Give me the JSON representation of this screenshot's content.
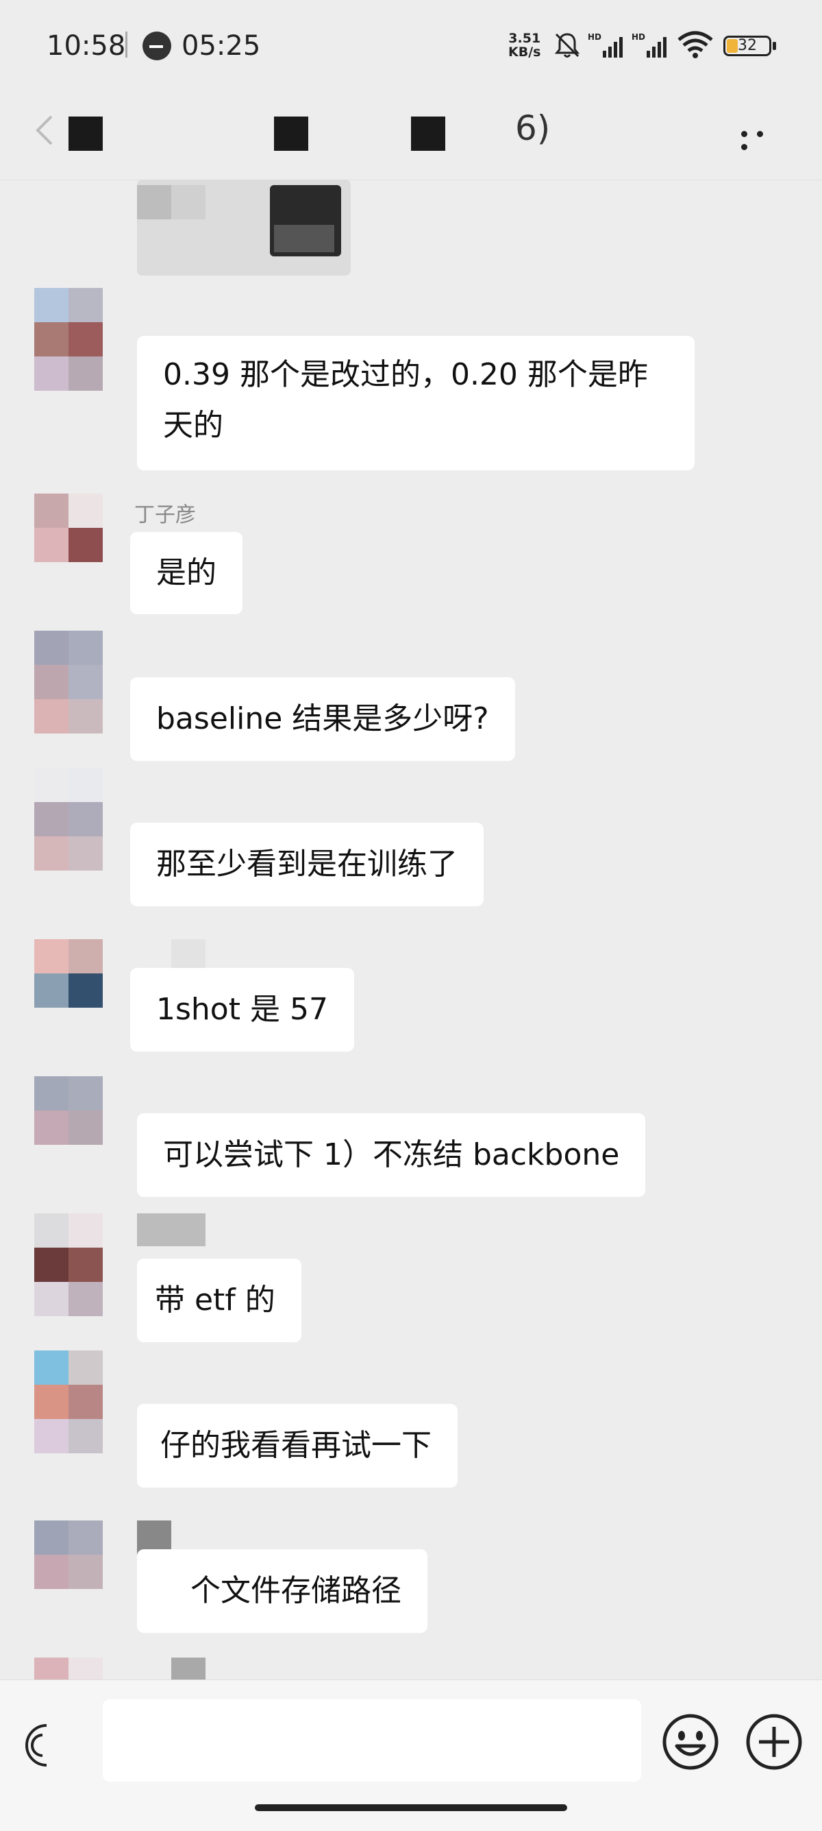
{
  "status_bar": {
    "time": "10:58",
    "clock_time": "05:25",
    "net_speed_value": "3.51",
    "net_speed_unit": "KB/s",
    "battery": "32"
  },
  "header": {
    "title_suffix": "6)",
    "back_icon": "chevron-left-icon",
    "more_icon": "more-horizontal-icon"
  },
  "messages": [
    {
      "sender": "",
      "text": ""
    },
    {
      "sender": "",
      "text": "0.39 那个是改过的，0.20 那个是昨天的"
    },
    {
      "sender": "丁子彦",
      "text": "是的"
    },
    {
      "sender": "",
      "text": "baseline 结果是多少呀?"
    },
    {
      "sender": "",
      "text": "那至少看到是在训练了"
    },
    {
      "sender": "",
      "text": "1shot 是 57"
    },
    {
      "sender": "",
      "text": "可以尝试下 1）不冻结 backbone"
    },
    {
      "sender": "",
      "text": "带 etf 的"
    },
    {
      "sender": "",
      "text": "仔的我看看再试一下"
    },
    {
      "sender": "",
      "text": "个文件存储路径"
    }
  ],
  "input_bar": {
    "voice_icon": "voice-icon",
    "emoji_icon": "emoji-icon",
    "plus_icon": "plus-icon"
  }
}
